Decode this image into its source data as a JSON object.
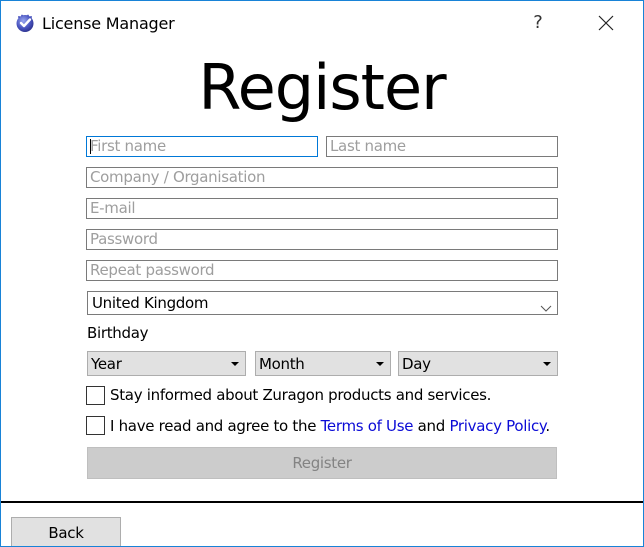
{
  "window": {
    "title": "License Manager",
    "app_icon": "shield-check-icon",
    "help_label": "?",
    "close_icon": "close-icon"
  },
  "form": {
    "heading": "Register",
    "first_name": {
      "placeholder": "First name",
      "value": ""
    },
    "last_name": {
      "placeholder": "Last name",
      "value": ""
    },
    "company": {
      "placeholder": "Company / Organisation",
      "value": ""
    },
    "email": {
      "placeholder": "E-mail",
      "value": ""
    },
    "password": {
      "placeholder": "Password",
      "value": ""
    },
    "repeat_password": {
      "placeholder": "Repeat password",
      "value": ""
    },
    "country": {
      "selected": "United Kingdom"
    },
    "birthday_label": "Birthday",
    "birthday": {
      "year": "Year",
      "month": "Month",
      "day": "Day"
    },
    "newsletter": {
      "label": "Stay informed about Zuragon products and services.",
      "checked": false
    },
    "terms": {
      "prefix": "I have read and agree to the ",
      "terms_link": "Terms of Use",
      "middle": " and ",
      "privacy_link": "Privacy Policy",
      "suffix": ".",
      "checked": false
    },
    "register_button": "Register",
    "link_color": "#0b0bd6"
  },
  "footer": {
    "back_button": "Back"
  }
}
